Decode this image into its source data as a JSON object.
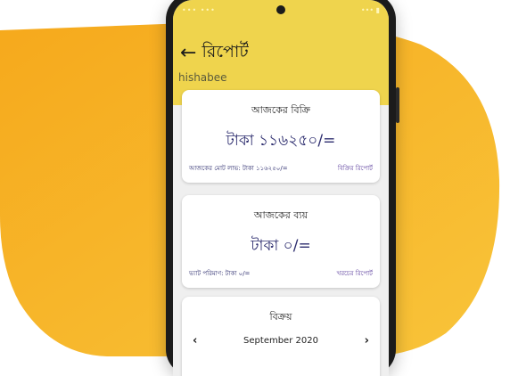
{
  "status": {
    "left": "••• •••",
    "right": "••• ▮"
  },
  "header": {
    "back_icon": "arrow-left-icon",
    "title": "রিপোর্ট",
    "app_name": "hishabee",
    "color": "#efd44d"
  },
  "sales_card": {
    "title": "আজকের বিক্রি",
    "amount": "টাকা ১১৬২৫০/=",
    "profit_text": "আজকের মোট লাভ: টাকা ১১৬২৫০/=",
    "report_link": "বিক্রির রিপোর্ট"
  },
  "expense_card": {
    "title": "আজকের ব্যয়",
    "amount": "টাকা ০/=",
    "vat_text": "ভ্যাট পরিমাণ: টাকা ০/=",
    "report_link": "খরচের রিপোর্ট"
  },
  "sell_card": {
    "title": "বিক্রয়",
    "month": "September 2020",
    "prev_icon": "chevron-left-icon",
    "next_icon": "chevron-right-icon"
  },
  "colors": {
    "accent": "#f5b21f",
    "header": "#efd44d",
    "text_blue": "#2c2c6e"
  }
}
